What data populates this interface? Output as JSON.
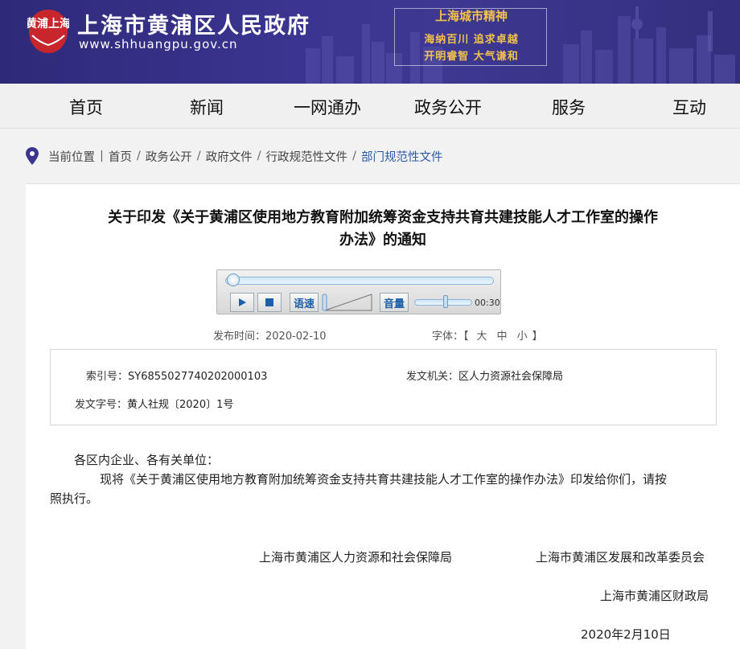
{
  "header": {
    "logo_text": "黄浦上海",
    "site_title": "上海市黄浦区人民政府",
    "site_url": "www.shhuangpu.gov.cn",
    "spirit_title": "上海城市精神",
    "spirit_line1": "海纳百川  追求卓越",
    "spirit_line2": "开明睿智  大气谦和"
  },
  "nav": [
    "首页",
    "新闻",
    "一网通办",
    "政务公开",
    "服务",
    "互动"
  ],
  "breadcrumb": {
    "label": "当前位置",
    "items": [
      "首页",
      "政务公开",
      "政府文件",
      "行政规范性文件",
      "部门规范性文件"
    ]
  },
  "article": {
    "title_line1": "关于印发《关于黄浦区使用地方教育附加统筹资金支持共育共建技能人才工作室的操作",
    "title_line2": "办法》的通知",
    "publish_label": "发布时间：",
    "publish_date": "2020-02-10",
    "font_label": "字体：",
    "font_open": "【",
    "font_close": "】",
    "font_sizes": [
      "大",
      "中",
      "小"
    ]
  },
  "player": {
    "speech_rate_label": "语速",
    "volume_label": "音量",
    "duration": "00:30",
    "progress": 0.0,
    "volume": 0.55
  },
  "info": {
    "index_label": "索引号：",
    "index_value": "SY68550277402020001​03",
    "issuer_label": "发文机关：",
    "issuer_value": "区人力资源社会保障局",
    "doc_no_label": "发文字号：",
    "doc_no_value": "黄人社规〔2020〕1号"
  },
  "body": {
    "salutation": "各区内企业、各有关单位：",
    "para1_line1": "现将《关于黄浦区使用地方教育附加统筹资金支持共育共建技能人才工作室的操作办法》印发给你们，请按",
    "para1_line2": "照执行。"
  },
  "signatures": {
    "sig1": "上海市黄浦区人力资源和社会保障局",
    "sig2": "上海市黄浦区发展和改革委员会",
    "sig3": "上海市黄浦区财政局",
    "date": "2020年2月10日"
  },
  "colors": {
    "header_bg": "#3a3590",
    "accent_gold": "#f3c24c",
    "link_blue": "#2b5aa6"
  }
}
